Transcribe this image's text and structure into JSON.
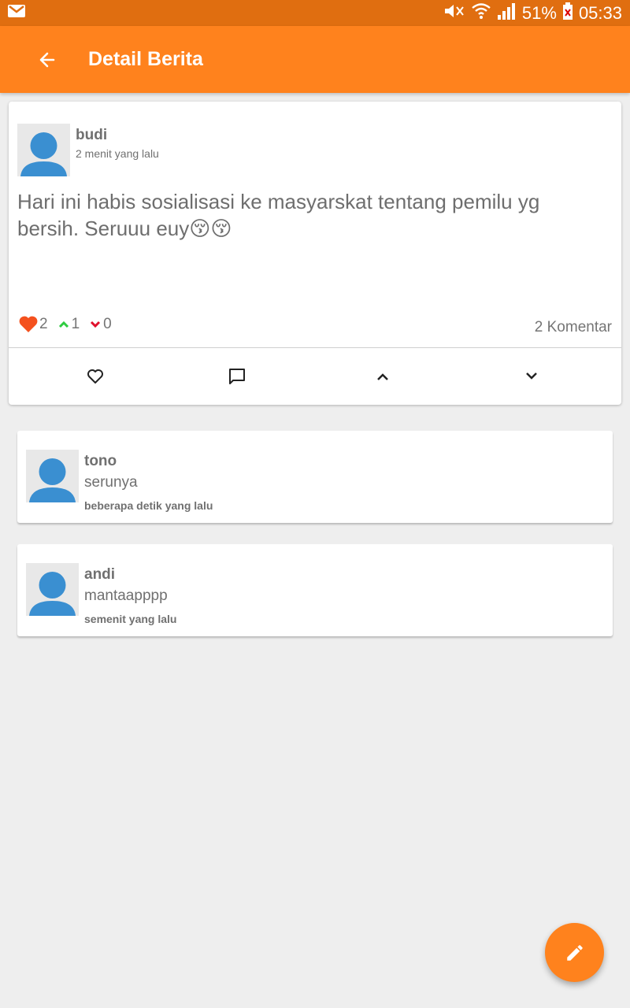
{
  "status_bar": {
    "battery": "51%",
    "time": "05:33"
  },
  "app_bar": {
    "title": "Detail Berita"
  },
  "post": {
    "user": "budi",
    "time": "2 menit yang lalu",
    "text": "Hari ini habis sosialisasi ke masyarskat tentang pemilu yg bersih. Seruuu euy😚😚",
    "likes": "2",
    "upvotes": "1",
    "downvotes": "0",
    "comment_count": "2",
    "comment_label": "Komentar"
  },
  "comments": [
    {
      "user": "tono",
      "text": "serunya",
      "time": "beberapa detik yang lalu"
    },
    {
      "user": "andi",
      "text": "mantaapppp",
      "time": "semenit yang lalu"
    }
  ],
  "colors": {
    "accent": "#ff821d",
    "status_bar": "#e06e10",
    "like": "#f4511e",
    "up": "#2ecc40",
    "down": "#e0102c",
    "avatar": "#3a8fd1"
  }
}
